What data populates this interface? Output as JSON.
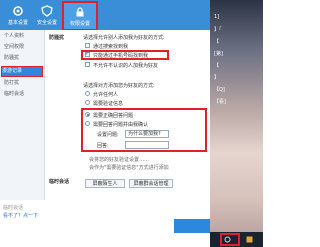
{
  "tabs": [
    {
      "label": "基本设置",
      "icon": "gear-icon"
    },
    {
      "label": "安全设置",
      "icon": "shield-icon"
    },
    {
      "label": "权限设置",
      "icon": "lock-icon"
    }
  ],
  "sidebar": {
    "items": [
      "个人资料",
      "空间权限",
      "防骚扰",
      "漫游记录",
      "防打扰",
      "临时会话"
    ]
  },
  "panel": {
    "anti_harass_label": "防骚扰",
    "way_heading": "请选择允许别人添加我为好友的方式:",
    "options": [
      {
        "label": "通过搜索找到我",
        "checked": false
      },
      {
        "label": "只能通过手机号码找到我",
        "checked": true
      },
      {
        "label": "不允许不认识的人加我为好友",
        "checked": false
      }
    ],
    "verify_heading": "请选择对方添加您为好友的方式:",
    "radios": [
      {
        "label": "允许任何人",
        "selected": false
      },
      {
        "label": "需要验证信息",
        "selected": false
      },
      {
        "label": "需要正确回答问题",
        "selected": true
      },
      {
        "label": "需要回答问题并由我确认",
        "selected": false
      }
    ],
    "question_label": "设置问题:",
    "question_value": "为什么要加我?",
    "answer_label": "回答:",
    "note_line1": "会将您的好友验证设置……",
    "note_line2": "会作为\"需要验证信息\"方式进行添加",
    "temp_label": "临时会话",
    "btn_block_stranger": "屏蔽陌生人",
    "btn_block_group": "屏蔽群会话管理",
    "bottom_link": "看不了？点一下",
    "bottom_note": "临时会话"
  },
  "right_panel": {
    "lines": [
      "1]",
      "】「",
      "【",
      "[第]",
      "【",
      "】",
      "【Q]",
      "【看]"
    ]
  },
  "colors": {
    "accent": "#3a8ed8",
    "highlight_border": "#e0202a",
    "selected_blue": "#2e86de"
  }
}
